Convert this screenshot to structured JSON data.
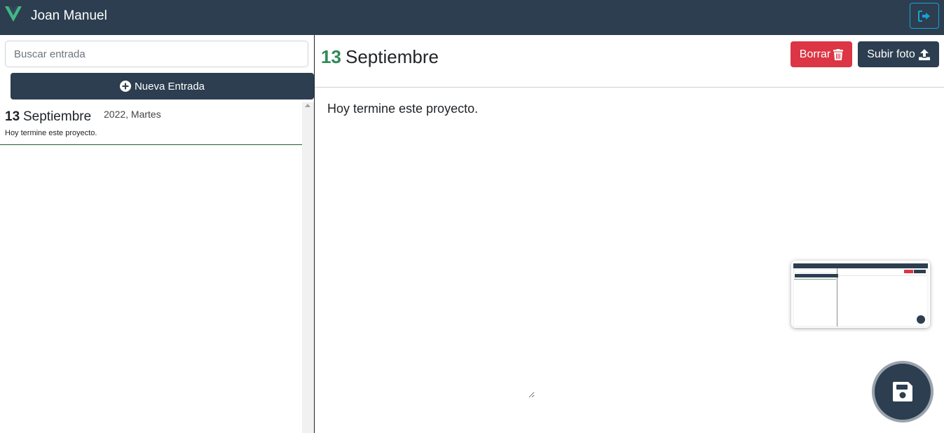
{
  "navbar": {
    "user_name": "Joan Manuel",
    "logo_icon": "vue-logo-icon",
    "logout_icon": "logout-icon",
    "brand_color": "#2c3e50",
    "logo_color": "#42b883"
  },
  "sidebar": {
    "search": {
      "placeholder": "Buscar entrada",
      "value": ""
    },
    "new_entry_label": "Nueva Entrada",
    "new_entry_icon": "plus-circle-icon",
    "entries": [
      {
        "day": "13",
        "month": "Septiembre",
        "year_weekday": "2022, Martes",
        "text": "Hoy termine este proyecto."
      }
    ]
  },
  "main": {
    "day": "13",
    "month": "Septiembre",
    "delete_label": "Borrar",
    "delete_icon": "trash-icon",
    "upload_label": "Subir foto",
    "upload_icon": "upload-icon",
    "entry_text": "Hoy termine este proyecto.",
    "save_icon": "floppy-disk-icon",
    "accent_color": "#2e8b57",
    "danger_color": "#dc3545"
  }
}
